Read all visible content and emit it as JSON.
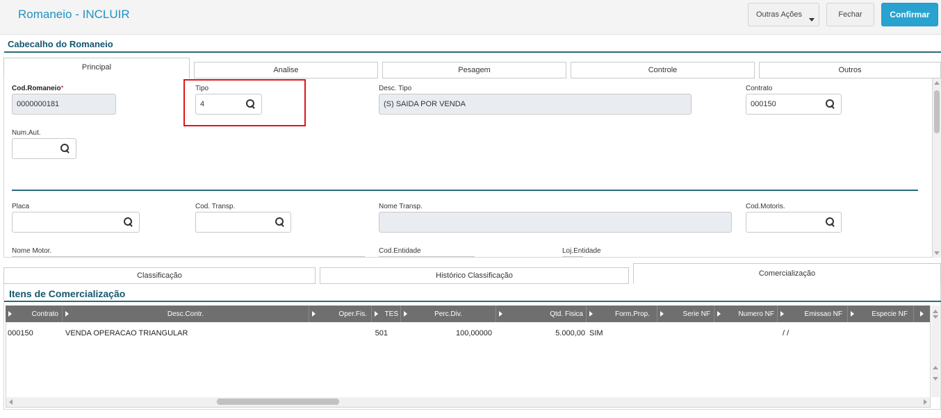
{
  "header": {
    "title": "Romaneio - INCLUIR",
    "buttons": {
      "outras": "Outras Ações",
      "fechar": "Fechar",
      "confirmar": "Confirmar"
    }
  },
  "cabecalho": {
    "section_title": "Cabecalho do Romaneio",
    "tabs": [
      "Principal",
      "Analise",
      "Pesagem",
      "Controle",
      "Outros"
    ],
    "fields": {
      "cod_romaneio": {
        "label": "Cod.Romaneio",
        "required": "*",
        "value": "0000000181"
      },
      "tipo": {
        "label": "Tipo",
        "value": "4"
      },
      "desc_tipo": {
        "label": "Desc. Tipo",
        "value": "(S) SAIDA POR VENDA"
      },
      "contrato": {
        "label": "Contrato",
        "value": "000150"
      },
      "num_aut": {
        "label": "Num.Aut.",
        "value": ""
      },
      "placa": {
        "label": "Placa",
        "value": ""
      },
      "cod_transp": {
        "label": "Cod. Transp.",
        "value": ""
      },
      "nome_transp": {
        "label": "Nome Transp.",
        "value": ""
      },
      "cod_motoris": {
        "label": "Cod.Motoris.",
        "value": ""
      },
      "nome_motor": {
        "label": "Nome Motor.",
        "value": ""
      },
      "cod_entidade": {
        "label": "Cod.Entidade",
        "value": ""
      },
      "loj_entidade": {
        "label": "Loj.Entidade",
        "value": ""
      }
    }
  },
  "lower_tabs": [
    "Classificação",
    "Histórico Classificação",
    "Comercialização"
  ],
  "itens": {
    "section_title": "Itens de Comercialização",
    "columns": [
      "Contrato",
      "Desc.Contr.",
      "Oper.Fis.",
      "TES",
      "Perc.Div.",
      "Qtd. Fisica",
      "Form.Prop.",
      "Serie NF",
      "Numero NF",
      "Emissao NF",
      "Especie NF"
    ],
    "rows": [
      {
        "contrato": "000150",
        "desc": "VENDA OPERACAO TRIANGULAR",
        "oper": "",
        "tes": "501",
        "perc": "100,00000",
        "qtd": "5.000,00",
        "form": "SIM",
        "serie": "",
        "numero": "",
        "emissao": " / /",
        "especie": ""
      }
    ]
  },
  "colors": {
    "accent": "#1e93c4",
    "confirm": "#2aa2d0",
    "section": "#14566e",
    "highlight": "#e0131b"
  }
}
